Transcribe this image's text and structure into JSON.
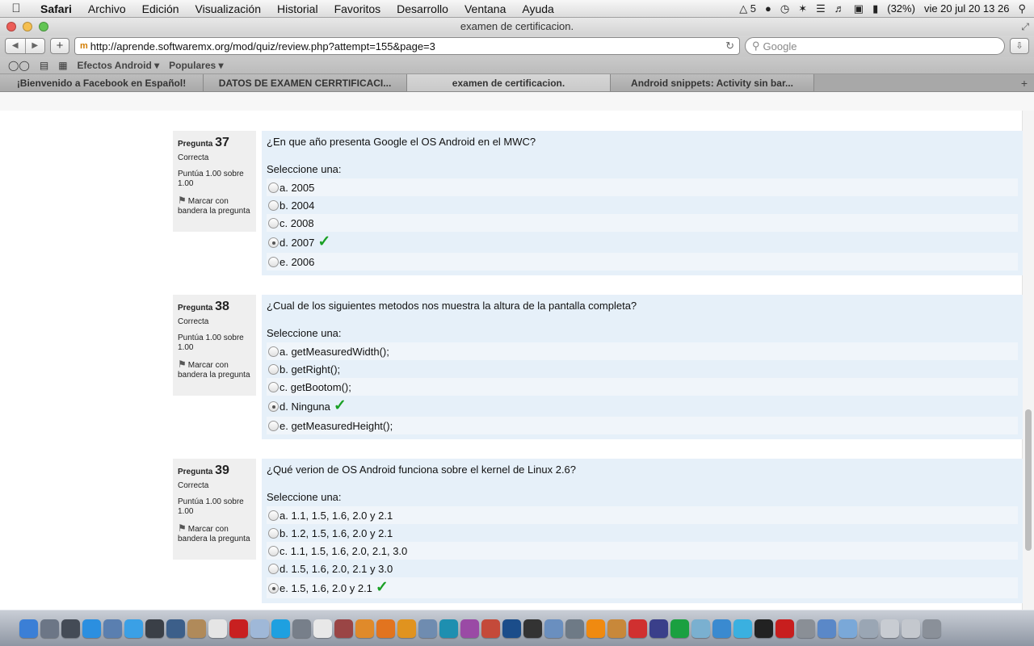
{
  "menubar": {
    "apple": "",
    "items": [
      "Safari",
      "Archivo",
      "Edición",
      "Visualización",
      "Historial",
      "Favoritos",
      "Desarrollo",
      "Ventana",
      "Ayuda"
    ],
    "adobe_count": "5",
    "battery": "(32%)",
    "clock": "vie 20 jul  20 13 26"
  },
  "window": {
    "title": "examen de certificacion.",
    "url": "http://aprende.softwaremx.org/mod/quiz/review.php?attempt=155&page=3",
    "favicon": "m",
    "search_placeholder": "Google"
  },
  "bookmarks": [
    "Efectos Android",
    "Populares"
  ],
  "tabs": [
    {
      "label": "¡Bienvenido a Facebook en Español!",
      "active": false
    },
    {
      "label": "DATOS DE EXAMEN CERRTIFICACI...",
      "active": false
    },
    {
      "label": "examen de certificacion.",
      "active": true
    },
    {
      "label": "Android snippets: Activity sin bar...",
      "active": false
    }
  ],
  "questions": [
    {
      "label": "Pregunta",
      "number": "37",
      "state": "Correcta",
      "grade": "Puntúa 1.00 sobre 1.00",
      "flag": "Marcar con bandera la pregunta",
      "text": "¿En que año presenta Google el OS Android en el MWC?",
      "prompt": "Seleccione una:",
      "options": [
        "a. 2005",
        "b. 2004",
        "c. 2008",
        "d. 2007",
        "e. 2006"
      ],
      "selected": 3
    },
    {
      "label": "Pregunta",
      "number": "38",
      "state": "Correcta",
      "grade": "Puntúa 1.00 sobre 1.00",
      "flag": "Marcar con bandera la pregunta",
      "text": "¿Cual de los siguientes metodos nos muestra la altura de la pantalla completa?",
      "prompt": "Seleccione una:",
      "options": [
        "a. getMeasuredWidth();",
        "b. getRight();",
        "c. getBootom();",
        "d. Ninguna",
        "e. getMeasuredHeight();"
      ],
      "selected": 3
    },
    {
      "label": "Pregunta",
      "number": "39",
      "state": "Correcta",
      "grade": "Puntúa 1.00 sobre 1.00",
      "flag": "Marcar con bandera la pregunta",
      "text": "¿Qué verion de OS Android funciona sobre el kernel de Linux 2.6?",
      "prompt": "Seleccione una:",
      "options": [
        "a. 1.1, 1.5, 1.6, 2.0 y 2.1",
        "b. 1.2, 1.5, 1.6, 2.0 y 2.1",
        "c. 1.1, 1.5, 1.6, 2.0, 2.1, 3.0",
        "d. 1.5, 1.6, 2.0, 2.1 y 3.0",
        "e. 1.5, 1.6, 2.0 y 2.1"
      ],
      "selected": 4
    }
  ],
  "dock_icons": [
    {
      "name": "finder-icon",
      "color": "#3b7fd6"
    },
    {
      "name": "launchpad-icon",
      "color": "#6c7686"
    },
    {
      "name": "mission-control-icon",
      "color": "#444b56"
    },
    {
      "name": "app-store-icon",
      "color": "#2b8fe0"
    },
    {
      "name": "preview-icon",
      "color": "#5a7fb0"
    },
    {
      "name": "safari-icon",
      "color": "#3aa0e6"
    },
    {
      "name": "facetime-icon",
      "color": "#3a3f47"
    },
    {
      "name": "xcode-icon",
      "color": "#3c5f8a"
    },
    {
      "name": "address-book-icon",
      "color": "#b08a5a"
    },
    {
      "name": "calendar-icon",
      "color": "#e5e5e5"
    },
    {
      "name": "filezilla-icon",
      "color": "#c82020"
    },
    {
      "name": "virtualbox-icon",
      "color": "#9fb8d8"
    },
    {
      "name": "skype-icon",
      "color": "#1ea0e0"
    },
    {
      "name": "utility-icon",
      "color": "#777f8a"
    },
    {
      "name": "textedit-icon",
      "color": "#e8e8e8"
    },
    {
      "name": "photo-booth-icon",
      "color": "#9a4545"
    },
    {
      "name": "blender-icon",
      "color": "#e08a2a"
    },
    {
      "name": "firefox-icon",
      "color": "#e2741f"
    },
    {
      "name": "illustrator-icon",
      "color": "#e0931f"
    },
    {
      "name": "people-icon",
      "color": "#6f8cb0"
    },
    {
      "name": "globe-icon",
      "color": "#1e8fb0"
    },
    {
      "name": "plugin-icon",
      "color": "#9a4aa5"
    },
    {
      "name": "angry-birds-icon",
      "color": "#c44a3a"
    },
    {
      "name": "photoshop-icon",
      "color": "#1b4d8a"
    },
    {
      "name": "unity-icon",
      "color": "#333333"
    },
    {
      "name": "virtualbox-vm-icon",
      "color": "#6a8fbf"
    },
    {
      "name": "network-icon",
      "color": "#6e7a86"
    },
    {
      "name": "vlc-icon",
      "color": "#f08a10"
    },
    {
      "name": "folder-app-icon",
      "color": "#c8883a"
    },
    {
      "name": "angry-birds-red-icon",
      "color": "#d03030"
    },
    {
      "name": "eclipse-icon",
      "color": "#3a3f8a"
    },
    {
      "name": "compass-icon",
      "color": "#1aa040"
    },
    {
      "name": "activity-monitor-icon",
      "color": "#7ab0d0"
    },
    {
      "name": "itunes-icon",
      "color": "#3a8ad0"
    },
    {
      "name": "twitter-icon",
      "color": "#3ab0e0"
    },
    {
      "name": "terminal-icon",
      "color": "#222222"
    },
    {
      "name": "flash-icon",
      "color": "#c81e1e"
    },
    {
      "name": "system-preferences-icon",
      "color": "#8a8f96"
    },
    {
      "name": "xcode-hammer-icon",
      "color": "#5a88c8"
    },
    {
      "name": "documents-icon",
      "color": "#7aa8d8"
    },
    {
      "name": "printer-icon",
      "color": "#9aa6b4"
    },
    {
      "name": "scanner-icon",
      "color": "#c8ccd2"
    },
    {
      "name": "downloads-icon",
      "color": "#c4c8ce"
    },
    {
      "name": "trash-icon",
      "color": "#8a9099"
    }
  ]
}
